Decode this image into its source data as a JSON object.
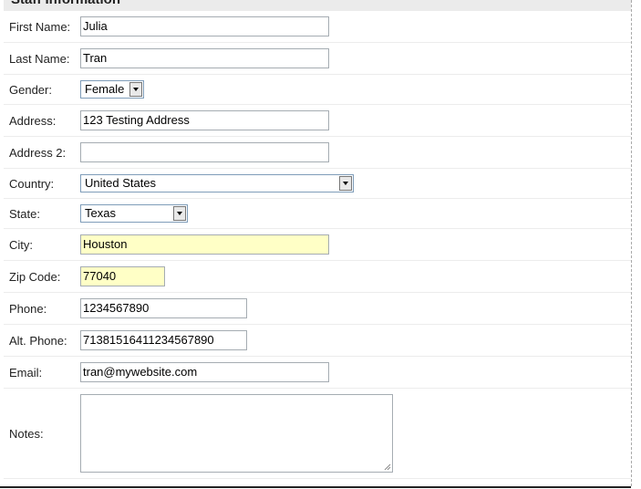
{
  "section": {
    "title": "Staff Information"
  },
  "form": {
    "first_name": {
      "label": "First Name:",
      "value": "Julia"
    },
    "last_name": {
      "label": "Last Name:",
      "value": "Tran"
    },
    "gender": {
      "label": "Gender:",
      "value": "Female"
    },
    "address": {
      "label": "Address:",
      "value": "123 Testing Address"
    },
    "address2": {
      "label": "Address 2:",
      "value": ""
    },
    "country": {
      "label": "Country:",
      "value": "United States"
    },
    "state": {
      "label": "State:",
      "value": "Texas"
    },
    "city": {
      "label": "City:",
      "value": "Houston"
    },
    "zip": {
      "label": "Zip Code:",
      "value": "77040"
    },
    "phone": {
      "label": "Phone:",
      "value": "1234567890"
    },
    "alt_phone": {
      "label": "Alt. Phone:",
      "value": "71381516411234567890"
    },
    "email": {
      "label": "Email:",
      "value": "tran@mywebsite.com"
    },
    "notes": {
      "label": "Notes:",
      "value": ""
    }
  },
  "colors": {
    "highlight": "#ffffc6",
    "header_bg": "#ebebeb"
  }
}
